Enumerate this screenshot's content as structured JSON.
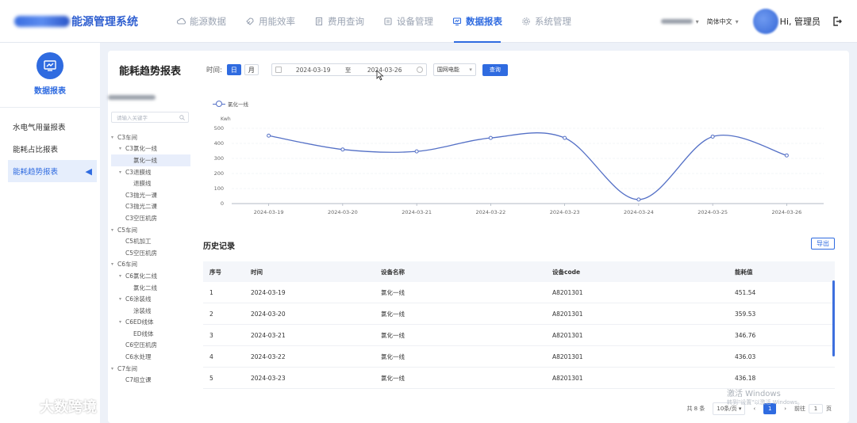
{
  "header": {
    "app_title": "能源管理系统",
    "nav": [
      {
        "label": "能源数据",
        "icon": "cloud-icon",
        "active": false
      },
      {
        "label": "用能效率",
        "icon": "rocket-icon",
        "active": false
      },
      {
        "label": "费用查询",
        "icon": "document-icon",
        "active": false
      },
      {
        "label": "设备管理",
        "icon": "device-icon",
        "active": false
      },
      {
        "label": "数据报表",
        "icon": "report-icon",
        "active": true
      },
      {
        "label": "系统管理",
        "icon": "gear-icon",
        "active": false
      }
    ],
    "language": "简体中文",
    "greeting": "Hi, 管理员"
  },
  "sidebar": {
    "title": "数据报表",
    "items": [
      {
        "label": "水电气用量报表"
      },
      {
        "label": "能耗占比报表"
      },
      {
        "label": "能耗趋势报表",
        "active": true
      }
    ]
  },
  "page": {
    "title": "能耗趋势报表",
    "time_label": "时间:",
    "mode_day": "日",
    "mode_month": "月",
    "date_start": "2024-03-19",
    "date_to": "至",
    "date_end": "2024-03-26",
    "energy_select": "国网电能",
    "query_button": "查询"
  },
  "tree": {
    "search_placeholder": "请输入关键字",
    "nodes": [
      {
        "label": "C3车间",
        "toggle": "▾",
        "indent": 0
      },
      {
        "label": "C3氯化一线",
        "toggle": "▾",
        "indent": 1
      },
      {
        "label": "氯化一线",
        "toggle": "",
        "indent": 2,
        "selected": true
      },
      {
        "label": "C3退膜线",
        "toggle": "▾",
        "indent": 1
      },
      {
        "label": "退膜线",
        "toggle": "",
        "indent": 2
      },
      {
        "label": "C3抛光一课",
        "toggle": "",
        "indent": 1
      },
      {
        "label": "C3抛光二课",
        "toggle": "",
        "indent": 1
      },
      {
        "label": "C3空压机房",
        "toggle": "",
        "indent": 1
      },
      {
        "label": "C5车间",
        "toggle": "▾",
        "indent": 0
      },
      {
        "label": "C5机加工",
        "toggle": "",
        "indent": 1
      },
      {
        "label": "C5空压机房",
        "toggle": "",
        "indent": 1
      },
      {
        "label": "C6车间",
        "toggle": "▾",
        "indent": 0
      },
      {
        "label": "C6氯化二线",
        "toggle": "▾",
        "indent": 1
      },
      {
        "label": "氯化二线",
        "toggle": "",
        "indent": 2
      },
      {
        "label": "C6涂装线",
        "toggle": "▾",
        "indent": 1
      },
      {
        "label": "涂装线",
        "toggle": "",
        "indent": 2
      },
      {
        "label": "C6ED线体",
        "toggle": "▾",
        "indent": 1
      },
      {
        "label": "ED线体",
        "toggle": "",
        "indent": 2
      },
      {
        "label": "C6空压机房",
        "toggle": "",
        "indent": 1
      },
      {
        "label": "C6水处理",
        "toggle": "",
        "indent": 1
      },
      {
        "label": "C7车间",
        "toggle": "▾",
        "indent": 0
      },
      {
        "label": "C7组立课",
        "toggle": "",
        "indent": 1
      }
    ]
  },
  "chart_data": {
    "type": "line",
    "x": [
      "2024-03-19",
      "2024-03-20",
      "2024-03-21",
      "2024-03-22",
      "2024-03-23",
      "2024-03-24",
      "2024-03-25",
      "2024-03-26"
    ],
    "series": [
      {
        "name": "氯化一线",
        "values": [
          451.54,
          359.53,
          346.76,
          436.03,
          436.18,
          27.0,
          445.0,
          320.0
        ]
      }
    ],
    "ylabel": "Kwh",
    "ylim": [
      0,
      500
    ],
    "yticks": [
      0,
      100,
      200,
      300,
      400,
      500
    ],
    "grid": true,
    "legend": "top-left",
    "color": "#5470c6"
  },
  "history": {
    "title": "历史记录",
    "export_button": "导出",
    "columns": [
      "序号",
      "时间",
      "设备名称",
      "设备code",
      "能耗值"
    ],
    "rows": [
      [
        "1",
        "2024-03-19",
        "氯化一线",
        "A8201301",
        "451.54"
      ],
      [
        "2",
        "2024-03-20",
        "氯化一线",
        "A8201301",
        "359.53"
      ],
      [
        "3",
        "2024-03-21",
        "氯化一线",
        "A8201301",
        "346.76"
      ],
      [
        "4",
        "2024-03-22",
        "氯化一线",
        "A8201301",
        "436.03"
      ],
      [
        "5",
        "2024-03-23",
        "氯化一线",
        "A8201301",
        "436.18"
      ]
    ]
  },
  "pager": {
    "total": "共 8 条",
    "page_size": "10条/页",
    "current": "1",
    "goto_label": "前往",
    "goto_value": "1",
    "page_suffix": "页"
  },
  "overlay": {
    "watermark": "激活 Windows",
    "watermark_sub": "转到\"设置\"以激活 Windows。",
    "brand_logo": "大数跨境"
  }
}
